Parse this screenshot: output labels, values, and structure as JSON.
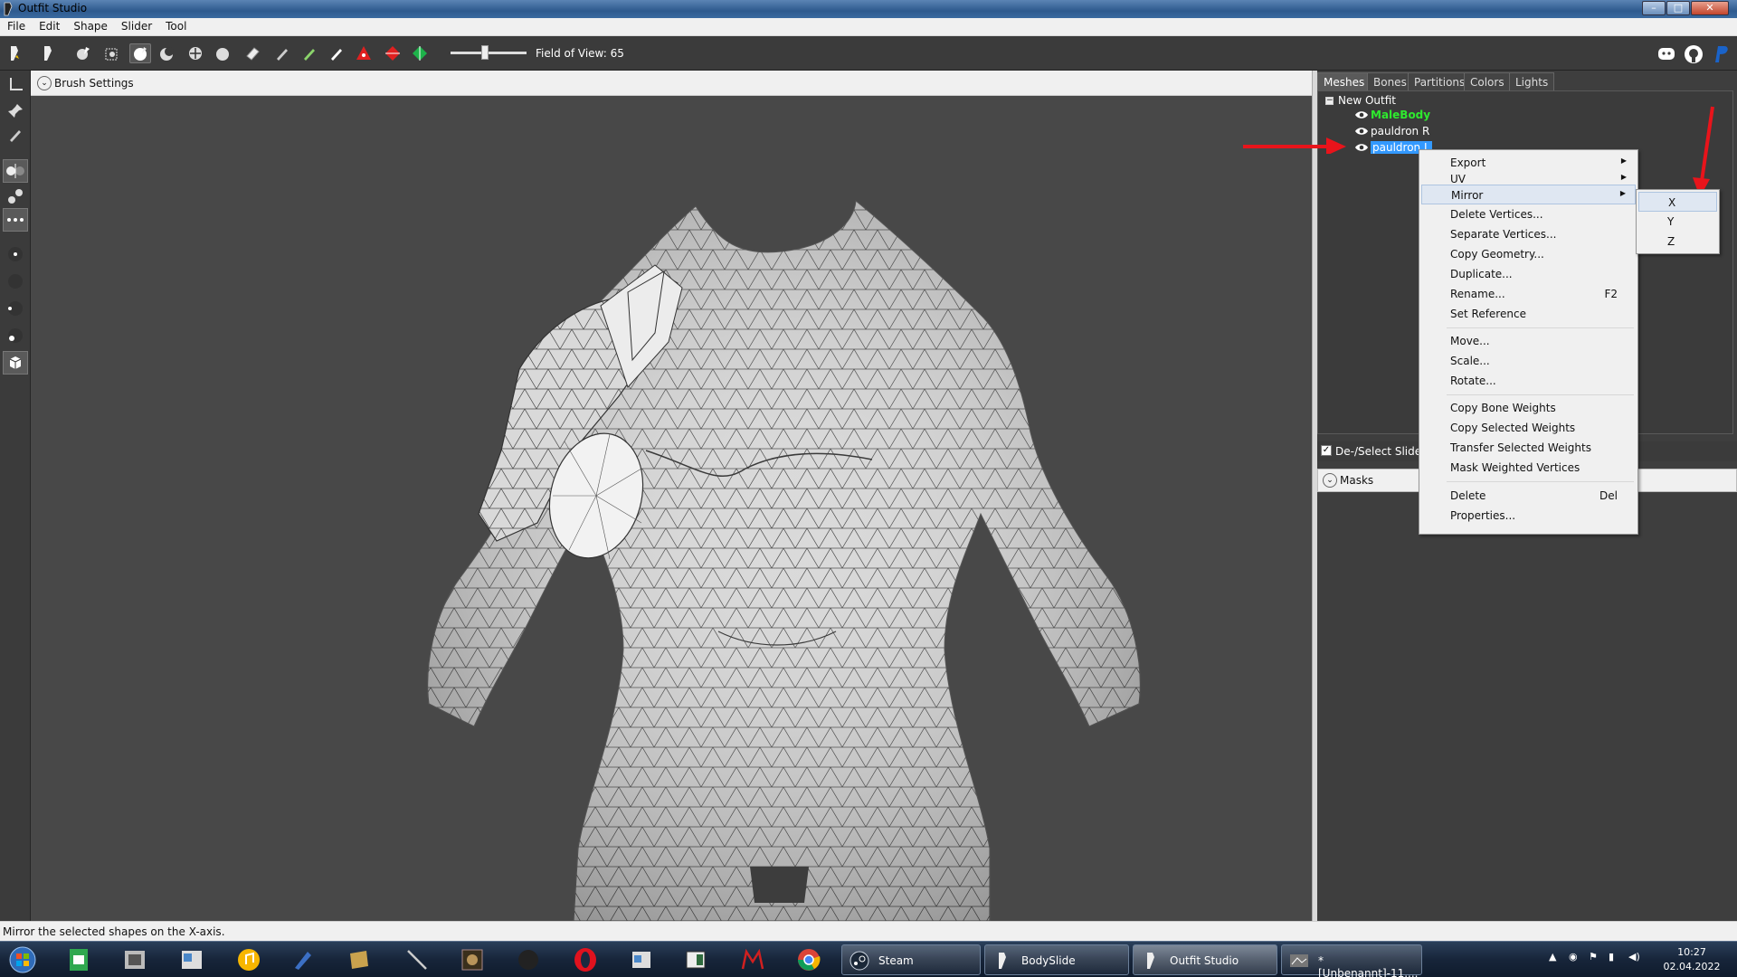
{
  "window": {
    "title": "Outfit Studio",
    "controls": [
      "–",
      "□",
      "✕"
    ]
  },
  "menu": [
    "File",
    "Edit",
    "Shape",
    "Slider",
    "Tool"
  ],
  "toolbar": {
    "fov_label": "Field of View: 65",
    "fov_value": 65
  },
  "brush_settings": {
    "label": "Brush Settings"
  },
  "tabs": [
    "Meshes",
    "Bones",
    "Partitions",
    "Colors",
    "Lights"
  ],
  "tree": {
    "root": "New Outfit",
    "toggle": "−",
    "items": [
      {
        "label": "MaleBody",
        "color": "#2eea2e"
      },
      {
        "label": "pauldron R",
        "color": "#ffffff"
      },
      {
        "label": "pauldron L",
        "color": "#ffffff",
        "selected": true
      }
    ]
  },
  "sliders": {
    "checkbox": "✓",
    "label": "De-/Select Sliders"
  },
  "masks": {
    "label": "Masks"
  },
  "context_menu": {
    "items": [
      {
        "label": "Export",
        "submenu": true
      },
      {
        "label": "UV",
        "submenu": true
      },
      {
        "label": "Mirror",
        "submenu": true,
        "highlighted": true
      },
      {
        "label": "Delete Vertices..."
      },
      {
        "label": "Separate Vertices..."
      },
      {
        "label": "Copy Geometry..."
      },
      {
        "label": "Duplicate..."
      },
      {
        "label": "Rename...",
        "shortcut": "F2"
      },
      {
        "label": "Set Reference"
      },
      {
        "label": "Move..."
      },
      {
        "label": "Scale..."
      },
      {
        "label": "Rotate..."
      },
      {
        "label": "Copy Bone Weights"
      },
      {
        "label": "Copy Selected Weights"
      },
      {
        "label": "Transfer Selected Weights"
      },
      {
        "label": "Mask Weighted Vertices"
      },
      {
        "label": "Delete",
        "shortcut": "Del"
      },
      {
        "label": "Properties..."
      }
    ],
    "arrow": "▶"
  },
  "mirror_submenu": [
    "X",
    "Y",
    "Z"
  ],
  "status": "Mirror the selected shapes on the X-axis.",
  "taskbar": {
    "buttons": [
      "Steam",
      "BodySlide",
      "Outfit Studio",
      "*[Unbenannt]-11...."
    ],
    "time": "10:27",
    "date": "02.04.2022"
  },
  "colors": {
    "accent": "#3399ff",
    "annotation_arrow": "#e8141b",
    "viewport": "#484848"
  }
}
